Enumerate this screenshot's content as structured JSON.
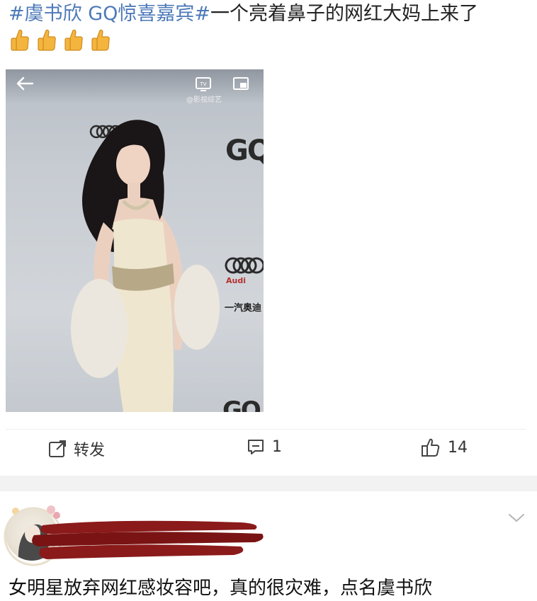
{
  "post": {
    "hashtag": "#虞书欣 GQ惊喜嘉宾#",
    "text": "一个亮着鼻子的网红大妈上来了",
    "emoji_count": 4,
    "emoji_icon": "thumbs-up-icon"
  },
  "video": {
    "watermark": "@影视综艺",
    "brand_gq": "GQ",
    "audi_label": "Audi",
    "audi_cn": "一汽奥迪"
  },
  "actions": {
    "repost_label": "转发",
    "comment_count": "1",
    "like_count": "14"
  },
  "comment": {
    "text": "女明星放弃网红感妆容吧，真的很灾难，点名虞书欣"
  },
  "colors": {
    "hashtag": "#4d79b8",
    "separator": "#f2f2f2",
    "redaction": "#8b1a1a"
  }
}
